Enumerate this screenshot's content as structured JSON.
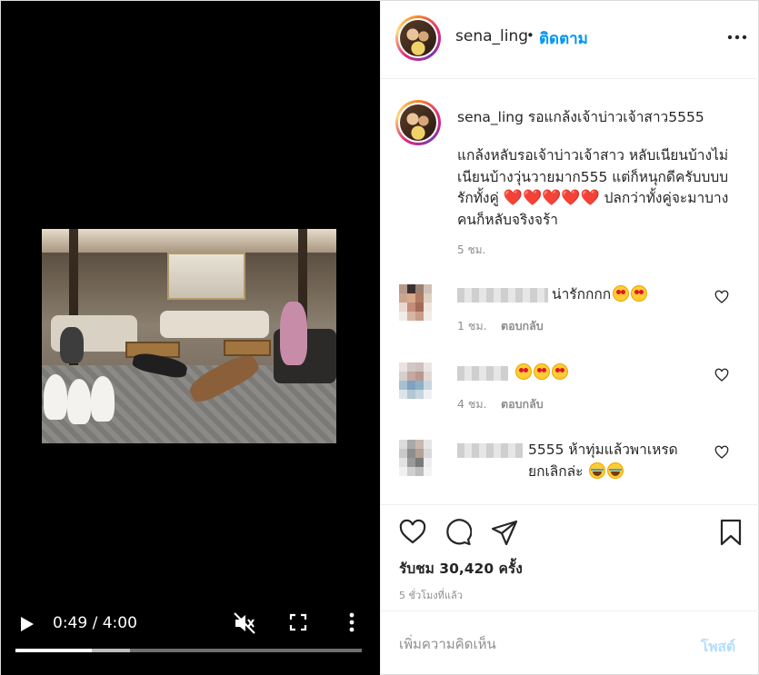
{
  "video": {
    "time_display": "0:49 / 4:00",
    "progress_played_fraction": 0.22,
    "progress_buffered_fraction": 0.33,
    "icons": [
      "play-icon",
      "mute-icon",
      "fullscreen-icon",
      "more-vertical-icon"
    ]
  },
  "header": {
    "username": "sena_ling",
    "dot": "•",
    "follow_label": "ติดตาม",
    "more_icon": "more-horizontal-icon"
  },
  "caption": {
    "username": "sena_ling",
    "title": "รอแกล้งเจ้าบ่าวเจ้าสาว5555",
    "body_part1": "แกล้งหลับรอเจ้าบ่าวเจ้าสาว หลับเนียนบ้างไม่เนียนบ้างวุ่นวายมาก555 แต่ก็หนุกดีครับบบบ รักทั้งคู่ ",
    "hearts": "❤️❤️❤️❤️❤️",
    "body_part2": " ปลกว่าทั้งคู่จะมาบางคนก็หลับจริงจร้า",
    "time": "5 ชม."
  },
  "comments": [
    {
      "text": "น่ารักกกก",
      "emojis": [
        "love",
        "love"
      ],
      "time": "1 ชม.",
      "reply_label": "ตอบกลับ"
    },
    {
      "text": "",
      "emojis": [
        "love",
        "love",
        "love"
      ],
      "time": "4 ชม.",
      "reply_label": "ตอบกลับ"
    },
    {
      "text": "5555 ห้าทุ่มแล้วพาเหรดยกเลิกล่ะ",
      "emojis": [
        "laugh",
        "laugh"
      ],
      "time": "",
      "reply_label": ""
    }
  ],
  "actions": {
    "icons": [
      "heart-icon",
      "comment-icon",
      "share-icon",
      "bookmark-icon"
    ],
    "views": "รับชม 30,420 ครั้ง",
    "posted": "5 ชั่วโมงที่แล้ว"
  },
  "comment_box": {
    "placeholder": "เพิ่มความคิดเห็น",
    "post_label": "โพสต์"
  },
  "colors": {
    "accent": "#0095f6",
    "post_disabled": "#b2dffc",
    "secondary_text": "#8e8e8e",
    "heart_red": "#e0162b"
  }
}
